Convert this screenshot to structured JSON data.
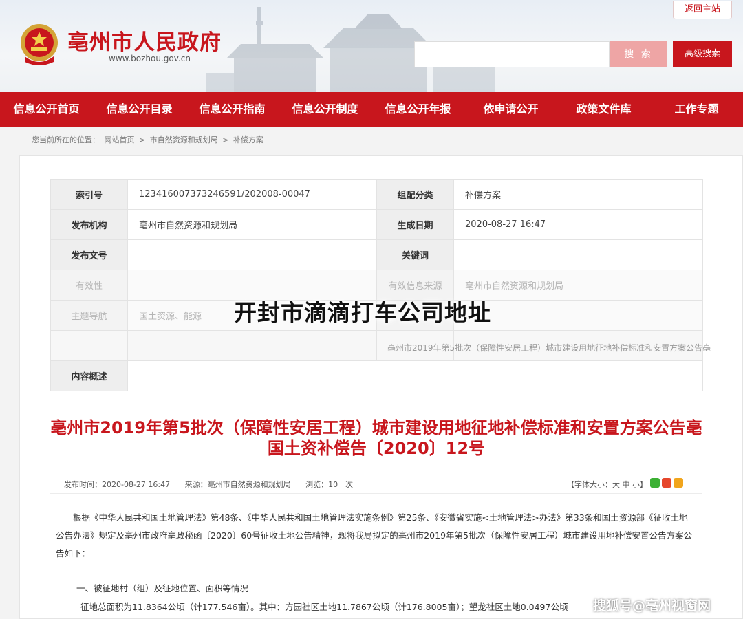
{
  "header": {
    "site_name": "亳州市人民政府",
    "site_url": "www.bozhou.gov.cn",
    "return_home": "返回主站",
    "search_placeholder": "",
    "search_button": "搜 索",
    "advanced_search": "高级搜索"
  },
  "nav": [
    "信息公开首页",
    "信息公开目录",
    "信息公开指南",
    "信息公开制度",
    "信息公开年报",
    "依申请公开",
    "政策文件库",
    "工作专题"
  ],
  "breadcrumb": {
    "prefix": "您当前所在的位置：",
    "items": [
      "网站首页",
      ">",
      "市自然资源和规划局",
      ">",
      "补偿方案"
    ]
  },
  "meta": {
    "index_label": "索引号",
    "index_value": "123416007373246591/202008-00047",
    "category_label": "组配分类",
    "category_value": "补偿方案",
    "publisher_label": "发布机构",
    "publisher_value": "亳州市自然资源和规划局",
    "date_label": "生成日期",
    "date_value": "2020-08-27 16:47",
    "docno_label": "发布文号",
    "docno_value": "",
    "keyword_label": "关键词",
    "keyword_value": "",
    "validity_label": "有效性",
    "validity_value": "",
    "source_label": "有效信息来源",
    "source_value": "亳州市自然资源和规划局",
    "topic_label": "主题导航",
    "topic_value": "国土资源、能源",
    "ghost_value": "亳州市2019年第5批次（保障性安居工程）城市建设用地征地补偿标准和安置方案公告亳",
    "summary_label": "内容概述",
    "summary_value": ""
  },
  "article": {
    "title": "亳州市2019年第5批次（保障性安居工程）城市建设用地征地补偿标准和安置方案公告亳国土资补偿告〔2020〕12号",
    "publish_time": "发布时间：2020-08-27 16:47",
    "source": "来源：亳州市自然资源和规划局",
    "views": "浏览：10　次",
    "font_size": "【字体大小：大 中 小】",
    "paragraph1": "根据《中华人民共和国土地管理法》第48条、《中华人民共和国土地管理法实施条例》第25条、《安徽省实施<土地管理法>办法》第33条和国土资源部《征收土地公告办法》规定及亳州市政府亳政秘函〔2020〕60号征收土地公告精神，现将我局拟定的亳州市2019年第5批次（保障性安居工程）城市建设用地补偿安置公告方案公告如下：",
    "section1": "一、被征地村（组）及征地位置、面积等情况",
    "paragraph2": "征地总面积为11.8364公顷（计177.546亩）。其中：方园社区土地11.7867公顷（计176.8005亩）；望龙社区土地0.0497公顷"
  },
  "overlay": {
    "title": "开封市滴滴打车公司地址",
    "watermark": "搜狐号@亳州视窗网"
  },
  "colors": {
    "brand_red": "#c8161d",
    "search_pink": "#eea5a5"
  }
}
